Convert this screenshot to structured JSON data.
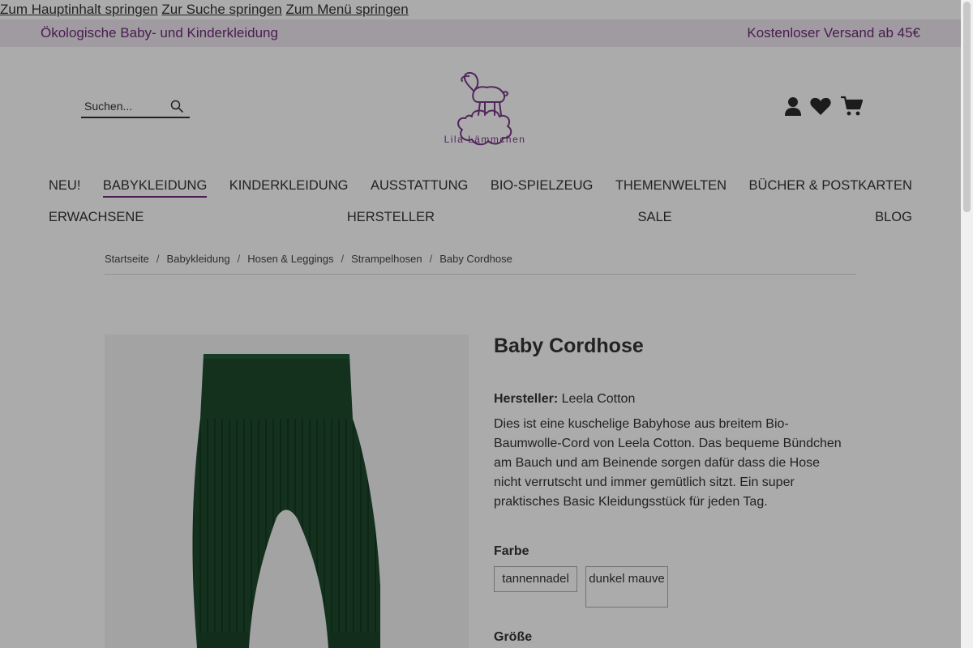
{
  "skip_links": [
    "Zum Hauptinhalt springen",
    "Zur Suche springen",
    "Zum Menü springen"
  ],
  "topbar": {
    "left_text": "Ökologische Baby- und Kinderkleidung",
    "right_text": "Kostenloser Versand ab 45€"
  },
  "search": {
    "placeholder": "Suchen...",
    "icon": "search-icon"
  },
  "logo": {
    "text": "Lila Lämmchen"
  },
  "header_icons": [
    "user-icon",
    "heart-icon",
    "cart-icon"
  ],
  "nav": {
    "row1": [
      "NEU!",
      "BABYKLEIDUNG",
      "KINDERKLEIDUNG",
      "AUSSTATTUNG",
      "BIO-SPIELZEUG",
      "THEMENWELTEN",
      "BÜCHER & POSTKARTEN"
    ],
    "row2": [
      "ERWACHSENE",
      "HERSTELLER",
      "SALE",
      "BLOG"
    ],
    "active": "BABYKLEIDUNG"
  },
  "breadcrumb": [
    "Startseite",
    "Babykleidung",
    "Hosen & Leggings",
    "Strampelhosen",
    "Baby Cordhose"
  ],
  "product": {
    "title": "Baby Cordhose",
    "manufacturer_label": "Hersteller:",
    "manufacturer": "Leela Cotton",
    "description": "Dies ist eine kuschelige Babyhose aus breitem Bio-Baumwolle-Cord von Leela Cotton. Das bequeme Bündchen am Bauch und am Beinende sorgen dafür dass die Hose nicht verrutscht und immer gemütlich sitzt. Ein super praktisches Basic Kleidungsstück für jeden Tag.",
    "color_label": "Farbe",
    "colors": [
      "tannennadel",
      "dunkel mauve"
    ],
    "size_label": "Größe"
  },
  "colors": {
    "brand": "#6e2a78",
    "topbar_bg": "#efe7f1",
    "pants": "#1f4a2e"
  }
}
